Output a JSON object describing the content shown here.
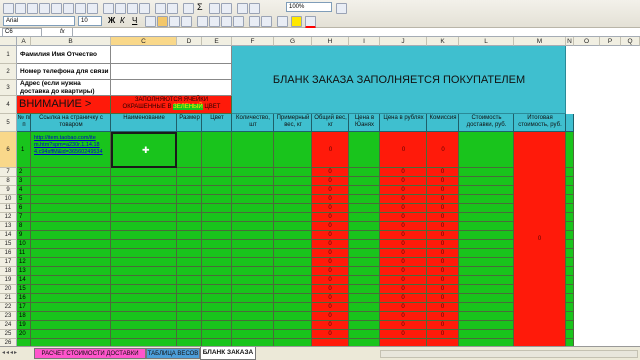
{
  "toolbar": {
    "font_name": "Arial",
    "font_size": "10",
    "zoom": "100%",
    "bold_label": "Ж",
    "italic_label": "К",
    "underline_label": "Ч",
    "sigma_label": "Σ"
  },
  "formula_bar": {
    "name_box": "C6",
    "fx": "fx"
  },
  "columns": [
    "A",
    "B",
    "C",
    "D",
    "E",
    "F",
    "G",
    "H",
    "I",
    "J",
    "K",
    "L",
    "M",
    "N",
    "O",
    "P",
    "Q"
  ],
  "rows": [
    "1",
    "2",
    "3",
    "4",
    "5",
    "6",
    "7",
    "8",
    "9",
    "10",
    "11",
    "12",
    "13",
    "14",
    "15",
    "16",
    "17",
    "18",
    "19",
    "20",
    "21",
    "22",
    "23",
    "24",
    "25",
    "26"
  ],
  "info_labels": {
    "name": "Фамилия Имя Отчество",
    "phone": "Номер телефона для связи",
    "address": "Адрес (если нужна доставка до квартиры)",
    "attention": "ВНИМАНИЕ >",
    "fill_note_1": "ЗАПОЛНЯЮТСЯ ЯЧЕЙКИ",
    "fill_note_2": "ОКРАШЕННЫЕ В",
    "fill_note_green": "ЗЕЛЕНЫЙ",
    "fill_note_3": "ЦВЕТ"
  },
  "banner": "БЛАНК ЗАКАЗА ЗАПОЛНЯЕТСЯ ПОКУПАТЕЛЕМ",
  "table_headers": {
    "num": "№ п/п",
    "link": "Ссылка на страничку с товаром",
    "name": "Наименование",
    "size": "Размер",
    "color": "Цвет",
    "qty": "Количество, шт",
    "approx_weight": "Примерный вес, кг",
    "total_weight": "Общий вес, кг",
    "price_yuan": "Цена в Юанях",
    "price_rub": "Цена в рублях",
    "commission": "Комиссия",
    "delivery_cost": "Стоимость доставки, руб.",
    "total_cost": "Итоговая стоимость, руб."
  },
  "first_row": {
    "num": "1",
    "link_line1": "http://item.taobao.com/ite",
    "link_line2": "m.htm?spm=a230r.1.14.18",
    "link_line3": "4.c94sffM&id=36560249534",
    "zero": "0"
  },
  "row_numbers": [
    "2",
    "3",
    "4",
    "5",
    "6",
    "7",
    "8",
    "9",
    "10",
    "11",
    "12",
    "13",
    "14",
    "15",
    "16",
    "17",
    "18",
    "19",
    "20"
  ],
  "zero_value": "0",
  "total_value": "0",
  "sheet_tabs": [
    "РАСЧЕТ СТОИМОСТИ ДОСТАВКИ",
    "ТАБЛИЦА ВЕСОВ",
    "БЛАНК ЗАКАЗА"
  ],
  "active_tab": "БЛАНК ЗАКАЗА",
  "colors": {
    "green": "#19c41c",
    "red": "#ff1a0a",
    "cyan": "#3fbfcf",
    "link": "#0000cc"
  }
}
